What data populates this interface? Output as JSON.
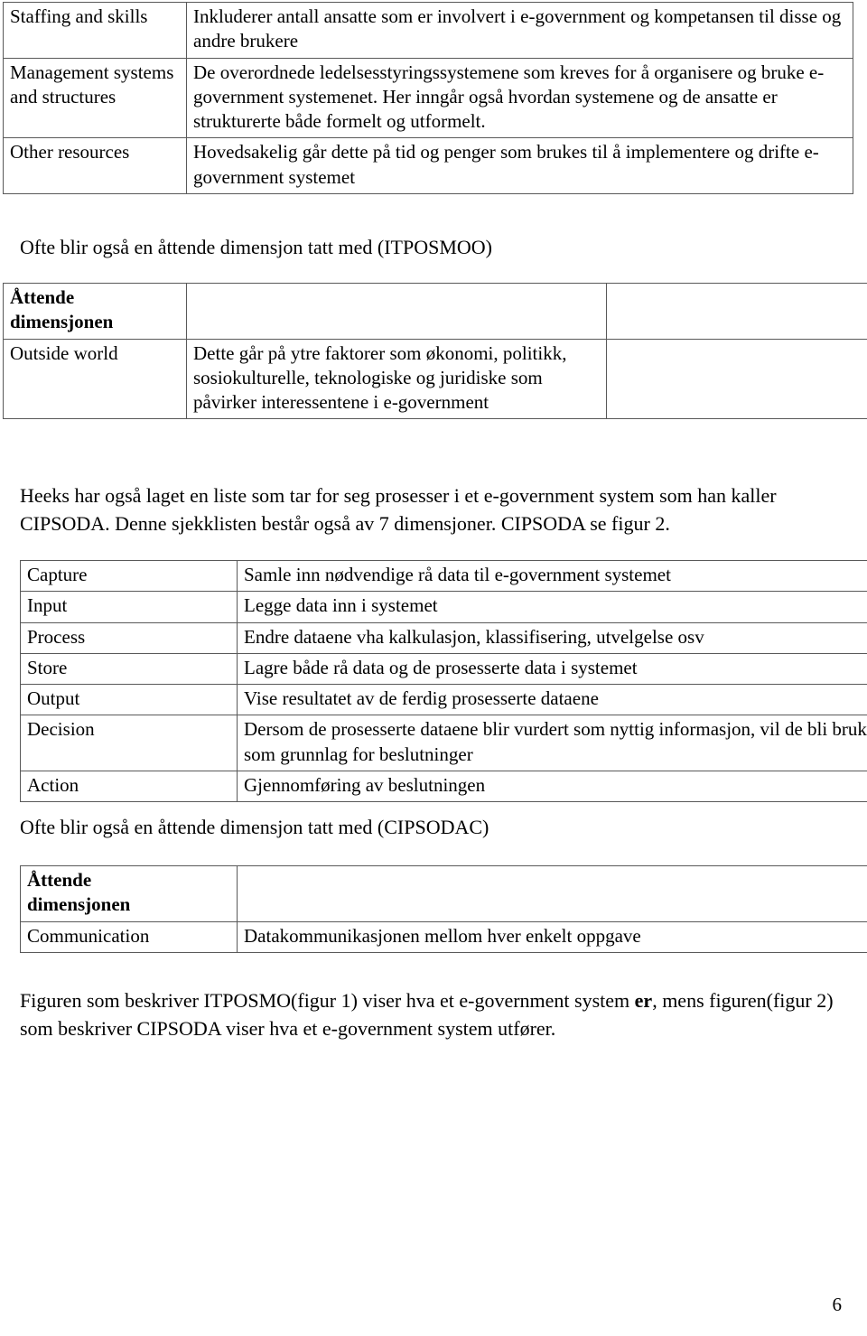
{
  "document": {
    "page_number": "6"
  },
  "table_itposmo_tail": {
    "rows": [
      {
        "dimension": "Staffing and skills",
        "description": "Inkluderer antall ansatte som er involvert i e-government og kompetansen til disse og andre brukere"
      },
      {
        "dimension": "Management systems and structures",
        "description": "De overordnede ledelsesstyringssystemene som kreves for å organisere og bruke e-government systemenet. Her inngår også hvordan systemene og de ansatte er strukturerte både formelt og utformelt."
      },
      {
        "dimension": "Other resources",
        "description": "Hovedsakelig går dette på tid og penger som brukes til å implementere og drifte e-government systemet"
      }
    ]
  },
  "heading_itposmoo": "Ofte blir også en åttende dimensjon tatt med (ITPOSMOO)",
  "table_itposmoo": {
    "header": {
      "label_line1": "Åttende",
      "label_line2": "dimensjonen",
      "col2": "",
      "col3": ""
    },
    "rows": [
      {
        "dimension": "Outside world",
        "description": "Dette går på ytre faktorer som økonomi, politikk, sosiokulturelle, teknologiske og juridiske som påvirker interessentene i e-government",
        "col3": ""
      }
    ]
  },
  "para_heeks": "Heeks har også laget en liste som tar for seg prosesser i et e-government system som han kaller CIPSODA. Denne sjekklisten består også av 7 dimensjoner. CIPSODA se figur 2.",
  "table_cipsoda": {
    "rows": [
      {
        "dimension": "Capture",
        "description": "Samle inn nødvendige rå data til e-government systemet"
      },
      {
        "dimension": "Input",
        "description": "Legge data inn i systemet"
      },
      {
        "dimension": "Process",
        "description": "Endre dataene vha kalkulasjon, klassifisering, utvelgelse osv"
      },
      {
        "dimension": "Store",
        "description": "Lagre både rå data og de prosesserte data i systemet"
      },
      {
        "dimension": "Output",
        "description": "Vise resultatet av de ferdig prosesserte dataene"
      },
      {
        "dimension": "Decision",
        "description": "Dersom de prosesserte dataene blir vurdert som nyttig informasjon, vil de bli brukt som grunnlag for beslutninger"
      },
      {
        "dimension": "Action",
        "description": "Gjennomføring av beslutningen"
      }
    ]
  },
  "heading_cipsodac": "Ofte blir også en åttende dimensjon tatt med (CIPSODAC)",
  "table_cipsodac": {
    "header": {
      "label_line1": "Åttende",
      "label_line2": "dimensjonen",
      "col2": ""
    },
    "rows": [
      {
        "dimension": "Communication",
        "description": "Datakommunikasjonen mellom hver enkelt oppgave"
      }
    ]
  },
  "para_figuren": {
    "part1": "Figuren som beskriver ITPOSMO(figur 1) viser hva et e-government system ",
    "emphasis": "er",
    "part2": ", mens figuren(figur 2) som beskriver CIPSODA viser hva et e-government system utfører."
  }
}
